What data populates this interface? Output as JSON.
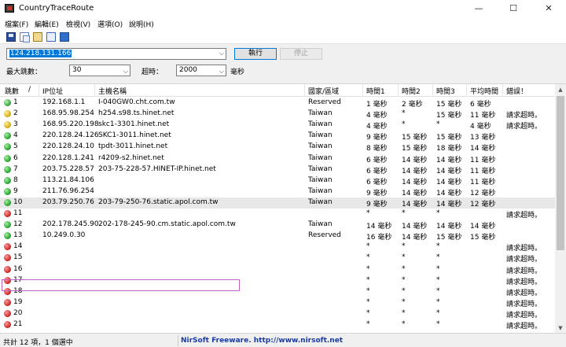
{
  "window": {
    "title": "CountryTraceRoute",
    "minimize": "—",
    "maximize": "☐",
    "close": "✕"
  },
  "menu": [
    "檔案(F)",
    "編輯(E)",
    "檢視(V)",
    "選項(O)",
    "說明(H)"
  ],
  "toolbar_icons": [
    "save-icon",
    "copy-icon",
    "properties-icon",
    "html-report-icon",
    "exit-icon"
  ],
  "target": {
    "value": "124.218.131.166",
    "run_label": "執行",
    "stop_label": "停止"
  },
  "options": {
    "max_hops_label": "最大跳數：",
    "max_hops_value": "30",
    "timeout_label": "超時：",
    "timeout_value": "2000",
    "timeout_unit": "毫秒"
  },
  "table": {
    "columns": [
      "跳數",
      "/",
      "IP位址",
      "主機名稱",
      "國家/區域",
      "時間1",
      "時間2",
      "時間3",
      "平均時間",
      "錯誤！"
    ],
    "rows": [
      {
        "hop": "1",
        "ip": "192.168.1.1",
        "host": "I-040GW0.cht.com.tw",
        "country": "Reserved",
        "t1": "1 毫秒",
        "t2": "2 毫秒",
        "t3": "15 毫秒",
        "avg": "6 毫秒",
        "err": "",
        "status": "special"
      },
      {
        "hop": "2",
        "ip": "168.95.98.254",
        "host": "h254.s98.ts.hinet.net",
        "country": "Taiwan",
        "t1": "4 毫秒",
        "t2": "*",
        "t3": "15 毫秒",
        "avg": "11 毫秒",
        "err": "請求超時。",
        "status": "yellow"
      },
      {
        "hop": "3",
        "ip": "168.95.220.198",
        "host": "skc1-3301.hinet.net",
        "country": "Taiwan",
        "t1": "4 毫秒",
        "t2": "*",
        "t3": "*",
        "avg": "4 毫秒",
        "err": "請求超時。",
        "status": "yellow"
      },
      {
        "hop": "4",
        "ip": "220.128.24.126",
        "host": "SKC1-3011.hinet.net",
        "country": "Taiwan",
        "t1": "9 毫秒",
        "t2": "15 毫秒",
        "t3": "15 毫秒",
        "avg": "13 毫秒",
        "err": "",
        "status": "green"
      },
      {
        "hop": "5",
        "ip": "220.128.24.10",
        "host": "tpdt-3011.hinet.net",
        "country": "Taiwan",
        "t1": "8 毫秒",
        "t2": "15 毫秒",
        "t3": "18 毫秒",
        "avg": "14 毫秒",
        "err": "",
        "status": "green"
      },
      {
        "hop": "6",
        "ip": "220.128.1.241",
        "host": "r4209-s2.hinet.net",
        "country": "Taiwan",
        "t1": "6 毫秒",
        "t2": "14 毫秒",
        "t3": "14 毫秒",
        "avg": "11 毫秒",
        "err": "",
        "status": "green"
      },
      {
        "hop": "7",
        "ip": "203.75.228.57",
        "host": "203-75-228-57.HINET-IP.hinet.net",
        "country": "Taiwan",
        "t1": "6 毫秒",
        "t2": "14 毫秒",
        "t3": "14 毫秒",
        "avg": "11 毫秒",
        "err": "",
        "status": "green"
      },
      {
        "hop": "8",
        "ip": "113.21.84.106",
        "host": "",
        "country": "Taiwan",
        "t1": "6 毫秒",
        "t2": "14 毫秒",
        "t3": "14 毫秒",
        "avg": "11 毫秒",
        "err": "",
        "status": "green"
      },
      {
        "hop": "9",
        "ip": "211.76.96.254",
        "host": "",
        "country": "Taiwan",
        "t1": "9 毫秒",
        "t2": "14 毫秒",
        "t3": "14 毫秒",
        "avg": "12 毫秒",
        "err": "",
        "status": "green"
      },
      {
        "hop": "10",
        "ip": "203.79.250.76",
        "host": "203-79-250-76.static.apol.com.tw",
        "country": "Taiwan",
        "t1": "9 毫秒",
        "t2": "14 毫秒",
        "t3": "14 毫秒",
        "avg": "12 毫秒",
        "err": "",
        "status": "green"
      },
      {
        "hop": "11",
        "ip": "",
        "host": "",
        "country": "",
        "t1": "*",
        "t2": "*",
        "t3": "*",
        "avg": "",
        "err": "請求超時。",
        "status": "red"
      },
      {
        "hop": "12",
        "ip": "202.178.245.90",
        "host": "202-178-245-90.cm.static.apol.com.tw",
        "country": "Taiwan",
        "t1": "14 毫秒",
        "t2": "14 毫秒",
        "t3": "14 毫秒",
        "avg": "14 毫秒",
        "err": "",
        "status": "green"
      },
      {
        "hop": "13",
        "ip": "10.249.0.30",
        "host": "",
        "country": "Reserved",
        "t1": "16 毫秒",
        "t2": "14 毫秒",
        "t3": "15 毫秒",
        "avg": "15 毫秒",
        "err": "",
        "status": "green"
      },
      {
        "hop": "14",
        "ip": "",
        "host": "",
        "country": "",
        "t1": "*",
        "t2": "*",
        "t3": "*",
        "avg": "",
        "err": "請求超時。",
        "status": "red"
      },
      {
        "hop": "15",
        "ip": "",
        "host": "",
        "country": "",
        "t1": "*",
        "t2": "*",
        "t3": "*",
        "avg": "",
        "err": "請求超時。",
        "status": "red"
      },
      {
        "hop": "16",
        "ip": "",
        "host": "",
        "country": "",
        "t1": "*",
        "t2": "*",
        "t3": "*",
        "avg": "",
        "err": "請求超時。",
        "status": "red"
      },
      {
        "hop": "17",
        "ip": "",
        "host": "",
        "country": "",
        "t1": "*",
        "t2": "*",
        "t3": "*",
        "avg": "",
        "err": "請求超時。",
        "status": "red"
      },
      {
        "hop": "18",
        "ip": "",
        "host": "",
        "country": "",
        "t1": "*",
        "t2": "*",
        "t3": "*",
        "avg": "",
        "err": "請求超時。",
        "status": "red"
      },
      {
        "hop": "19",
        "ip": "",
        "host": "",
        "country": "",
        "t1": "*",
        "t2": "*",
        "t3": "*",
        "avg": "",
        "err": "請求超時。",
        "status": "red"
      },
      {
        "hop": "20",
        "ip": "",
        "host": "",
        "country": "",
        "t1": "*",
        "t2": "*",
        "t3": "*",
        "avg": "",
        "err": "請求超時。",
        "status": "red"
      },
      {
        "hop": "21",
        "ip": "",
        "host": "",
        "country": "",
        "t1": "*",
        "t2": "*",
        "t3": "*",
        "avg": "",
        "err": "請求超時。",
        "status": "red"
      }
    ]
  },
  "status": {
    "count_text": "共計 12 項，1 個選中",
    "link_text": "NirSoft Freeware.  http://www.nirsoft.net"
  }
}
